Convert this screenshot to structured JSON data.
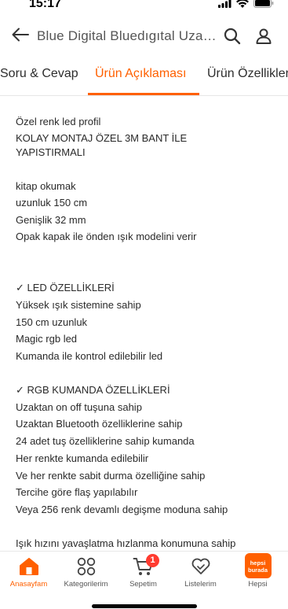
{
  "status_bar": {
    "time": "15:17",
    "icons": [
      "signal-icon",
      "wifi-icon",
      "battery-icon"
    ]
  },
  "header": {
    "title": "Blue Digital Bluedıgıtal Uzaktan Kumandalı...",
    "icons": [
      "back-arrow-icon",
      "search-icon",
      "user-icon"
    ]
  },
  "tabs": [
    {
      "label": "Soru & Cevap",
      "active": false
    },
    {
      "label": "Ürün Açıklaması",
      "active": true
    },
    {
      "label": "Ürün Özellikleri",
      "active": false
    }
  ],
  "description": {
    "lines": [
      " Özel renk led profil",
      "KOLAY MONTAJ ÖZEL 3M BANT İLE",
      "YAPISTIRMALI",
      "",
      "kitap okumak",
      "uzunluk 150 cm",
      "Genişlik 32 mm",
      "Opak kapak ile önden ışık modelini verir",
      "",
      "",
      "✓ LED ÖZELLİKLERİ",
      "Yüksek ışık sistemine sahip",
      "150 cm uzunluk",
      "Magic rgb led",
      "Kumanda ile kontrol edilebilir led",
      "",
      "✓ RGB KUMANDA ÖZELLİKLERİ",
      "Uzaktan on off tuşuna sahip",
      "Uzaktan Bluetooth özelliklerine sahip",
      "24 adet tuş özelliklerine sahip kumanda",
      "Her renkte kumanda edilebilir",
      "Ve her renkte sabit durma özelliğine sahip",
      "Tercihe göre flaş yapılabılır",
      "Veya 256 renk devamlı degişme moduna sahip",
      "",
      "Işık hızını yavaşlatma hızlanma konumuna sahip"
    ]
  },
  "bottom_nav": {
    "items": [
      {
        "label": "Anasayfam",
        "icon": "home-icon",
        "active": true
      },
      {
        "label": "Kategorilerim",
        "icon": "categories-icon",
        "active": false
      },
      {
        "label": "Sepetim",
        "icon": "cart-icon",
        "active": false,
        "badge": "1"
      },
      {
        "label": "Listelerim",
        "icon": "heart-list-icon",
        "active": false
      },
      {
        "label": "Hepsi",
        "icon": "hepsiburada-logo-icon",
        "active": false,
        "logo_text": "hepsi burada"
      }
    ]
  },
  "colors": {
    "accent": "#ff6000",
    "badge": "#ff3b30"
  }
}
